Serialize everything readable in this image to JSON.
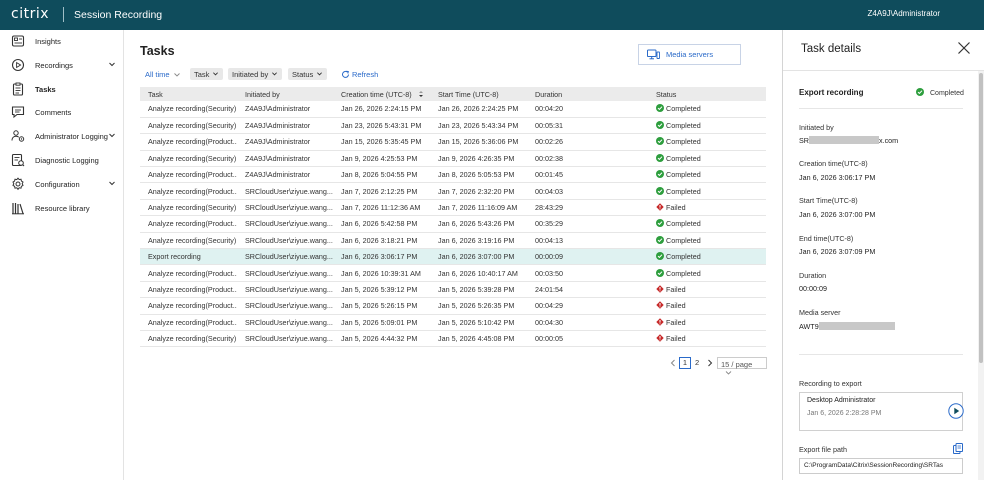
{
  "topbar": {
    "brand": "citrix",
    "product": "Session Recording",
    "user": "Z4A9J\\Administrator"
  },
  "sidebar": {
    "items": [
      {
        "label": "Insights",
        "icon": "insights-icon"
      },
      {
        "label": "Recordings",
        "icon": "recordings-icon",
        "expandable": true
      },
      {
        "label": "Tasks",
        "icon": "tasks-icon",
        "active": true
      },
      {
        "label": "Comments",
        "icon": "comments-icon"
      },
      {
        "label": "Administrator Logging",
        "icon": "admin-logging-icon",
        "expandable": true
      },
      {
        "label": "Diagnostic Logging",
        "icon": "diagnostic-logging-icon"
      },
      {
        "label": "Configuration",
        "icon": "configuration-icon",
        "expandable": true
      },
      {
        "label": "Resource library",
        "icon": "resource-library-icon"
      }
    ]
  },
  "main": {
    "title": "Tasks",
    "media_servers_label": "Media servers",
    "filters": {
      "time": "All time",
      "task": "Task",
      "initiated_by": "Initiated by",
      "status": "Status",
      "refresh": "Refresh"
    },
    "columns": [
      "Task",
      "Initiated by",
      "Creation time (UTC-8)",
      "Start Time (UTC-8)",
      "Duration",
      "Status"
    ],
    "rows": [
      {
        "task": "Analyze recording(Security)",
        "by": "Z4A9J\\Administrator",
        "created": "Jan 26, 2026 2:24:15 PM",
        "start": "Jan 26, 2026 2:24:25 PM",
        "duration": "00:04:20",
        "status": "Completed"
      },
      {
        "task": "Analyze recording(Security)",
        "by": "Z4A9J\\Administrator",
        "created": "Jan 23, 2026 5:43:31 PM",
        "start": "Jan 23, 2026 5:43:34 PM",
        "duration": "00:05:31",
        "status": "Completed"
      },
      {
        "task": "Analyze recording(Product...",
        "by": "Z4A9J\\Administrator",
        "created": "Jan 15, 2026 5:35:45 PM",
        "start": "Jan 15, 2026 5:36:06 PM",
        "duration": "00:02:26",
        "status": "Completed"
      },
      {
        "task": "Analyze recording(Security)",
        "by": "Z4A9J\\Administrator",
        "created": "Jan 9, 2026 4:25:53 PM",
        "start": "Jan 9, 2026 4:26:35 PM",
        "duration": "00:02:38",
        "status": "Completed"
      },
      {
        "task": "Analyze recording(Product...",
        "by": "Z4A9J\\Administrator",
        "created": "Jan 8, 2026 5:04:55 PM",
        "start": "Jan 8, 2026 5:05:53 PM",
        "duration": "00:01:45",
        "status": "Completed"
      },
      {
        "task": "Analyze recording(Product...",
        "by": "SRCloudUser\\ziyue.wang...",
        "created": "Jan 7, 2026 2:12:25 PM",
        "start": "Jan 7, 2026 2:32:20 PM",
        "duration": "00:04:03",
        "status": "Completed"
      },
      {
        "task": "Analyze recording(Security)",
        "by": "SRCloudUser\\ziyue.wang...",
        "created": "Jan 7, 2026 11:12:36 AM",
        "start": "Jan 7, 2026 11:16:09 AM",
        "duration": "28:43:29",
        "status": "Failed"
      },
      {
        "task": "Analyze recording(Product...",
        "by": "SRCloudUser\\ziyue.wang...",
        "created": "Jan 6, 2026 5:42:58 PM",
        "start": "Jan 6, 2026 5:43:26 PM",
        "duration": "00:35:29",
        "status": "Completed"
      },
      {
        "task": "Analyze recording(Security)",
        "by": "SRCloudUser\\ziyue.wang...",
        "created": "Jan 6, 2026 3:18:21 PM",
        "start": "Jan 6, 2026 3:19:16 PM",
        "duration": "00:04:13",
        "status": "Completed"
      },
      {
        "task": "Export recording",
        "by": "SRCloudUser\\ziyue.wang...",
        "created": "Jan 6, 2026 3:06:17 PM",
        "start": "Jan 6, 2026 3:07:00 PM",
        "duration": "00:00:09",
        "status": "Completed",
        "selected": true
      },
      {
        "task": "Analyze recording(Product...",
        "by": "SRCloudUser\\ziyue.wang...",
        "created": "Jan 6, 2026 10:39:31 AM",
        "start": "Jan 6, 2026 10:40:17 AM",
        "duration": "00:03:50",
        "status": "Completed"
      },
      {
        "task": "Analyze recording(Product...",
        "by": "SRCloudUser\\ziyue.wang...",
        "created": "Jan 5, 2026 5:39:12 PM",
        "start": "Jan 5, 2026 5:39:28 PM",
        "duration": "24:01:54",
        "status": "Failed"
      },
      {
        "task": "Analyze recording(Product...",
        "by": "SRCloudUser\\ziyue.wang...",
        "created": "Jan 5, 2026 5:26:15 PM",
        "start": "Jan 5, 2026 5:26:35 PM",
        "duration": "00:04:29",
        "status": "Failed"
      },
      {
        "task": "Analyze recording(Product...",
        "by": "SRCloudUser\\ziyue.wang...",
        "created": "Jan 5, 2026 5:09:01 PM",
        "start": "Jan 5, 2026 5:10:42 PM",
        "duration": "00:04:30",
        "status": "Failed"
      },
      {
        "task": "Analyze recording(Security)",
        "by": "SRCloudUser\\ziyue.wang...",
        "created": "Jan 5, 2026 4:44:32 PM",
        "start": "Jan 5, 2026 4:45:08 PM",
        "duration": "00:00:05",
        "status": "Failed"
      }
    ],
    "pagination": {
      "page1": "1",
      "page2": "2",
      "per_page": "15 / page"
    }
  },
  "details": {
    "title": "Task details",
    "task_name": "Export recording",
    "status": "Completed",
    "initiated_by_label": "Initiated by",
    "initiated_by_prefix": "SR",
    "initiated_by_suffix": "x.com",
    "creation_label": "Creation time(UTC-8)",
    "creation_value": "Jan 6, 2026 3:06:17 PM",
    "start_label": "Start Time(UTC-8)",
    "start_value": "Jan 6, 2026 3:07:00 PM",
    "end_label": "End time(UTC-8)",
    "end_value": "Jan 6, 2026 3:07:09 PM",
    "duration_label": "Duration",
    "duration_value": "00:00:09",
    "media_label": "Media server",
    "media_prefix": "AWT9",
    "recording_label": "Recording to export",
    "recording_name": "Desktop Administrator",
    "recording_time": "Jan 6, 2026 2:28:28 PM",
    "path_label": "Export file path",
    "path_value": "C:\\ProgramData\\Citrix\\SessionRecording\\SRTas"
  },
  "colors": {
    "topbar": "#0f4c5c",
    "accent": "#2a6ac9",
    "success": "#2e9e3e",
    "failed": "#c62828",
    "selected_row": "#dff2f1"
  }
}
